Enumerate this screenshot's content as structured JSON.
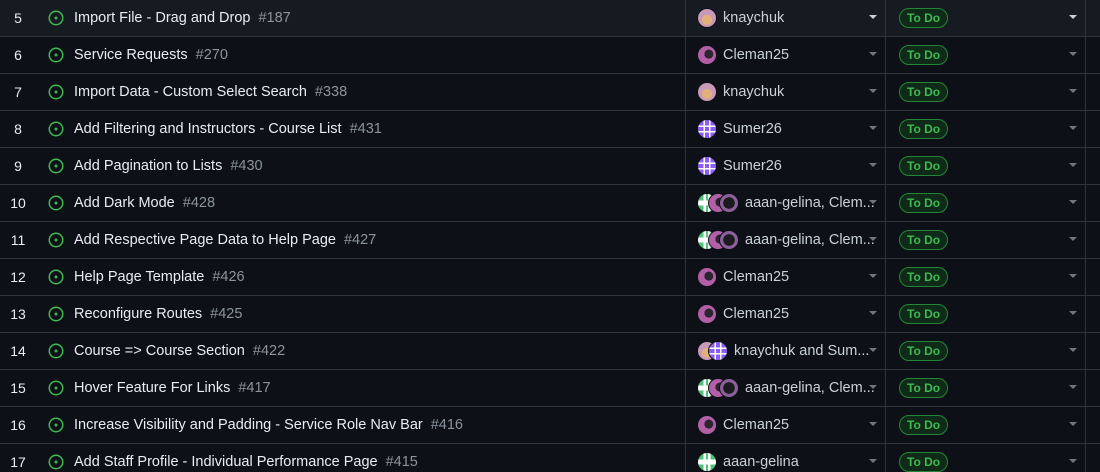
{
  "status_color": "#3fb950",
  "issue_icon": "issue-opened-icon",
  "rows": [
    {
      "number": "5",
      "title": "Import File - Drag and Drop",
      "id": "#187",
      "avatars": [
        "knaychuk"
      ],
      "assignee": "knaychuk",
      "status": "To Do",
      "selected": true
    },
    {
      "number": "6",
      "title": "Service Requests",
      "id": "#270",
      "avatars": [
        "cleman"
      ],
      "assignee": "Cleman25",
      "status": "To Do"
    },
    {
      "number": "7",
      "title": "Import Data - Custom Select Search",
      "id": "#338",
      "avatars": [
        "knaychuk"
      ],
      "assignee": "knaychuk",
      "status": "To Do"
    },
    {
      "number": "8",
      "title": "Add Filtering and Instructors - Course List",
      "id": "#431",
      "avatars": [
        "sumer"
      ],
      "assignee": "Sumer26",
      "status": "To Do"
    },
    {
      "number": "9",
      "title": "Add Pagination to Lists",
      "id": "#430",
      "avatars": [
        "sumer"
      ],
      "assignee": "Sumer26",
      "status": "To Do"
    },
    {
      "number": "10",
      "title": "Add Dark Mode",
      "id": "#428",
      "avatars": [
        "aaan",
        "cleman",
        "dark"
      ],
      "assignee": "aaan-gelina, Clem...",
      "status": "To Do"
    },
    {
      "number": "11",
      "title": "Add Respective Page Data to Help Page",
      "id": "#427",
      "avatars": [
        "aaan",
        "cleman",
        "dark"
      ],
      "assignee": "aaan-gelina, Clem...",
      "status": "To Do"
    },
    {
      "number": "12",
      "title": "Help Page Template",
      "id": "#426",
      "avatars": [
        "cleman"
      ],
      "assignee": "Cleman25",
      "status": "To Do"
    },
    {
      "number": "13",
      "title": "Reconfigure Routes",
      "id": "#425",
      "avatars": [
        "cleman"
      ],
      "assignee": "Cleman25",
      "status": "To Do"
    },
    {
      "number": "14",
      "title": "Course => Course Section",
      "id": "#422",
      "avatars": [
        "knaychuk",
        "sumer"
      ],
      "assignee": "knaychuk and Sum...",
      "status": "To Do"
    },
    {
      "number": "15",
      "title": "Hover Feature For Links",
      "id": "#417",
      "avatars": [
        "aaan",
        "cleman",
        "dark"
      ],
      "assignee": "aaan-gelina, Clem...",
      "status": "To Do"
    },
    {
      "number": "16",
      "title": "Increase Visibility and Padding - Service Role Nav Bar",
      "id": "#416",
      "avatars": [
        "cleman"
      ],
      "assignee": "Cleman25",
      "status": "To Do"
    },
    {
      "number": "17",
      "title": "Add Staff Profile - Individual Performance Page",
      "id": "#415",
      "avatars": [
        "aaan"
      ],
      "assignee": "aaan-gelina",
      "status": "To Do"
    }
  ]
}
